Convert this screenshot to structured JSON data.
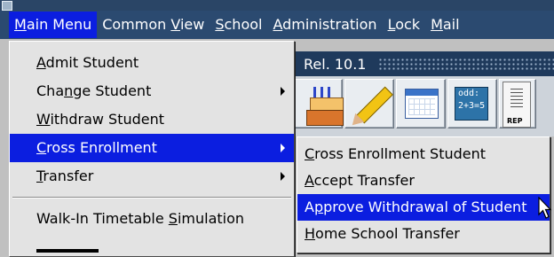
{
  "menubar": {
    "items": [
      {
        "label": "Main Menu",
        "u": "M"
      },
      {
        "label": "Common View",
        "u": "V"
      },
      {
        "label": "School",
        "u": "S"
      },
      {
        "label": "Administration",
        "u": "A"
      },
      {
        "label": "Lock",
        "u": "L"
      },
      {
        "label": "Mail",
        "u": "M"
      }
    ]
  },
  "background": {
    "release": "Rel. 10.1",
    "toolbar_icons": [
      "birthday-cake-icon",
      "pencil-icon",
      "calendar-icon",
      "math-odd-icon",
      "report-icon"
    ],
    "odd_icon_text": [
      "odd:",
      "2+3=5"
    ],
    "report_label": "REP"
  },
  "main_menu": {
    "items": [
      {
        "label": "Admit Student",
        "u": "A",
        "submenu": false
      },
      {
        "label": "Change Student",
        "u": "n",
        "submenu": true
      },
      {
        "label": "Withdraw Student",
        "u": "W",
        "submenu": false
      },
      {
        "label": "Cross Enrollment",
        "u": "C",
        "submenu": true,
        "active": true
      },
      {
        "label": "Transfer",
        "u": "T",
        "submenu": true
      },
      {
        "label": "Walk-In Timetable Simulation",
        "u": "S",
        "submenu": false,
        "separator_before": true
      }
    ]
  },
  "cross_enrollment_submenu": {
    "items": [
      {
        "label": "Cross Enrollment Student",
        "u": "C"
      },
      {
        "label": "Accept Transfer",
        "u": "A"
      },
      {
        "label": "Approve Withdrawal of Student",
        "u": "p",
        "active": true
      },
      {
        "label": "Home School Transfer",
        "u": "H"
      }
    ]
  },
  "colors": {
    "menu_highlight": "#0b1ee0",
    "menubar_bg": "#2b4a70",
    "menu_bg": "#e3e3e3"
  }
}
